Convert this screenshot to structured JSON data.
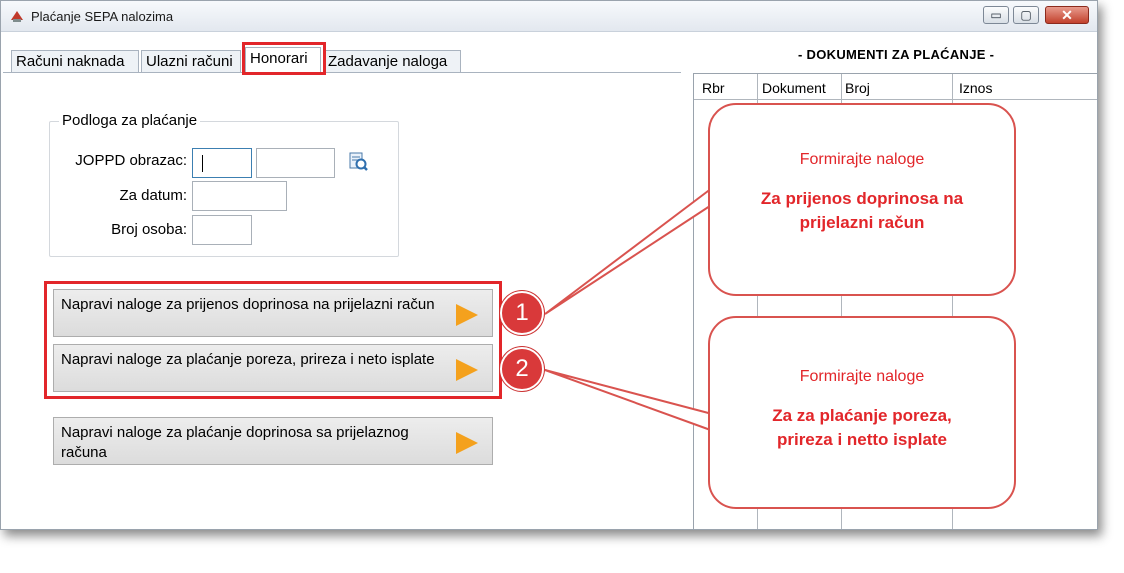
{
  "window": {
    "title": "Plaćanje SEPA nalozima",
    "controls": {
      "minimize": "▭",
      "maximize": "▢",
      "close": "✕"
    }
  },
  "tabs": [
    {
      "label": "Računi naknada"
    },
    {
      "label": "Ulazni računi"
    },
    {
      "label": "Honorari"
    },
    {
      "label": "Zadavanje naloga"
    }
  ],
  "form": {
    "group_title": "Podloga za plaćanje",
    "joppd_label": "JOPPD obrazac:",
    "za_datum_label": "Za datum:",
    "broj_osoba_label": "Broj osoba:"
  },
  "buttons": [
    {
      "label": "Napravi naloge za prijenos doprinosa na prijelazni račun"
    },
    {
      "label": "Napravi naloge za plaćanje poreza, prireza i neto isplate"
    },
    {
      "label": "Napravi naloge za plaćanje doprinosa sa prijelaznog računa"
    }
  ],
  "documents": {
    "title": "- DOKUMENTI ZA PLAĆANJE -",
    "columns": [
      "Rbr",
      "Dokument",
      "Broj",
      "Iznos"
    ]
  },
  "callouts": [
    {
      "number": "1",
      "line1": "Formirajte naloge",
      "line2": "Za prijenos doprinosa na prijelazni račun"
    },
    {
      "number": "2",
      "line1": "Formirajte naloge",
      "line2": "Za za plaćanje poreza, prireza i netto isplate"
    }
  ],
  "colors": {
    "highlight": "#e2262a",
    "play_icon": "#f4a11d"
  }
}
